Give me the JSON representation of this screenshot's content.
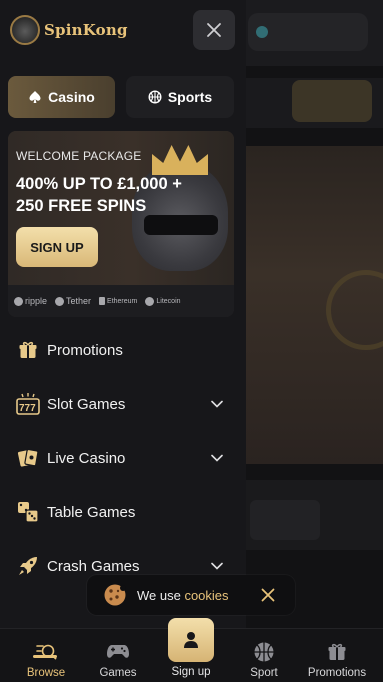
{
  "brand": {
    "name": "SpinKong",
    "color": "#e8c37a"
  },
  "tabs": [
    {
      "label": "Casino",
      "icon": "spade-icon",
      "active": true
    },
    {
      "label": "Sports",
      "icon": "sports-ball-icon",
      "active": false
    }
  ],
  "promo": {
    "kicker": "WELCOME PACKAGE",
    "headline_line1": "400% UP TO £1,000 +",
    "headline_line2": "250 FREE SPINS",
    "cta_label": "SIGN UP",
    "payments": [
      "ripple",
      "Tether",
      "Ethereum",
      "Litecoin"
    ]
  },
  "menu": [
    {
      "label": "Promotions",
      "icon": "gift-icon",
      "expandable": false
    },
    {
      "label": "Slot Games",
      "icon": "slot-777-icon",
      "expandable": true
    },
    {
      "label": "Live Casino",
      "icon": "cards-icon",
      "expandable": true
    },
    {
      "label": "Table Games",
      "icon": "dice-icon",
      "expandable": false
    },
    {
      "label": "Crash Games",
      "icon": "rocket-icon",
      "expandable": true
    }
  ],
  "cookie_banner": {
    "prefix": "We use ",
    "link": "cookies"
  },
  "bottom_nav": [
    {
      "label": "Browse",
      "icon": "browse-search-icon",
      "active": true
    },
    {
      "label": "Games",
      "icon": "gamepad-icon",
      "active": false
    },
    {
      "label": "Sign up",
      "icon": "user-icon",
      "active": false
    },
    {
      "label": "Sport",
      "icon": "basketball-icon",
      "active": false
    },
    {
      "label": "Promotions",
      "icon": "gift-icon",
      "active": false
    }
  ],
  "colors": {
    "accent": "#e8c37a",
    "panel": "#17171a",
    "cta_gold": "#e7c98a"
  }
}
